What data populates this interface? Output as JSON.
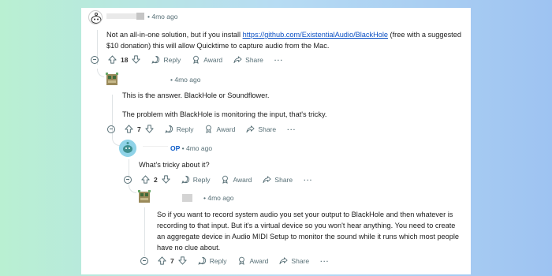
{
  "comment1": {
    "time": "• 4mo ago",
    "text_before": "Not an all-in-one solution, but if you install ",
    "link": "https://github.com/ExistentialAudio/BlackHole",
    "text_after": " (free with a suggested $10 donation) this will allow Quicktime to capture audio from the Mac.",
    "votes": "18",
    "reply": "Reply",
    "award": "Award",
    "share": "Share",
    "more": "···"
  },
  "comment2": {
    "time": "• 4mo ago",
    "line1": "This is the answer. BlackHole or Soundflower.",
    "line2": "The problem with BlackHole is monitoring the input, that's tricky.",
    "votes": "7",
    "reply": "Reply",
    "award": "Award",
    "share": "Share",
    "more": "···"
  },
  "comment3": {
    "op": "OP",
    "time": "• 4mo ago",
    "text": "What's tricky about it?",
    "votes": "2",
    "reply": "Reply",
    "award": "Award",
    "share": "Share",
    "more": "···"
  },
  "comment4": {
    "time": "• 4mo ago",
    "text": "So if you want to record system audio you set your output to BlackHole and then whatever is recording to that input. But it's a virtual device so you won't hear anything. You need to create an aggregate device in Audio MIDI Setup to monitor the sound while it runs which most people have no clue about.",
    "votes": "7",
    "reply": "Reply",
    "award": "Award",
    "share": "Share",
    "more": "···"
  }
}
